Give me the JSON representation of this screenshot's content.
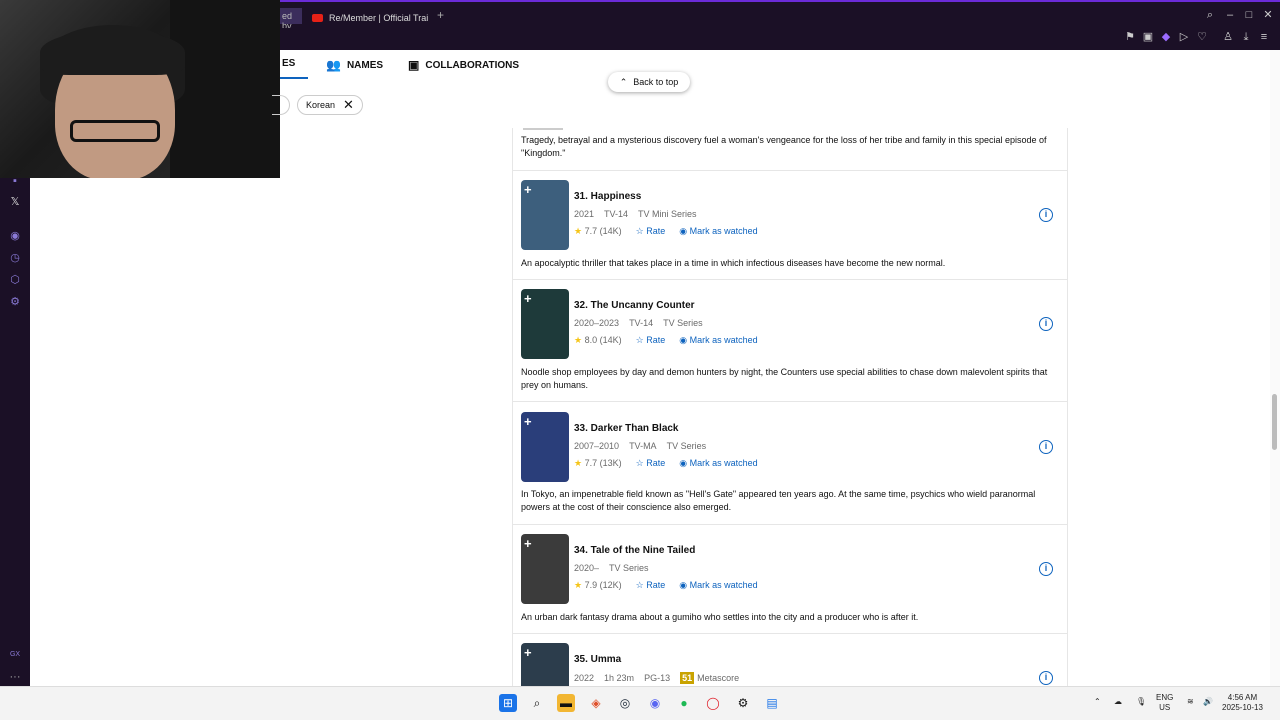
{
  "browser": {
    "tab_partial": "ed by",
    "tab_active": "Re/Member | Official Trai",
    "new_tab": "+"
  },
  "nav": {
    "item_partial": "ES",
    "names": "NAMES",
    "collaborations": "COLLABORATIONS"
  },
  "back_to_top": "Back to top",
  "filters": {
    "chip": "Korean"
  },
  "previous_description": "Tragedy, betrayal and a mysterious discovery fuel a woman's vengeance for the loss of her tribe and family in this special episode of \"Kingdom.\"",
  "actions": {
    "rate": "Rate",
    "watched": "Mark as watched"
  },
  "items": [
    {
      "title": "31. Happiness",
      "meta": [
        "2021",
        "TV-14",
        "TV Mini Series"
      ],
      "rating": "7.7",
      "votes": "(14K)",
      "desc": "An apocalyptic thriller that takes place in a time in which infectious diseases have become the new normal.",
      "poster_color": "#3d5f7d"
    },
    {
      "title": "32. The Uncanny Counter",
      "meta": [
        "2020–2023",
        "TV-14",
        "TV Series"
      ],
      "rating": "8.0",
      "votes": "(14K)",
      "desc": "Noodle shop employees by day and demon hunters by night, the Counters use special abilities to chase down malevolent spirits that prey on humans.",
      "poster_color": "#1e3a3a"
    },
    {
      "title": "33. Darker Than Black",
      "meta": [
        "2007–2010",
        "TV-MA",
        "TV Series"
      ],
      "rating": "7.7",
      "votes": "(13K)",
      "desc": "In Tokyo, an impenetrable field known as \"Hell's Gate\" appeared ten years ago. At the same time, psychics who wield paranormal powers at the cost of their conscience also emerged.",
      "poster_color": "#2a3e7a"
    },
    {
      "title": "34. Tale of the Nine Tailed",
      "meta": [
        "2020–",
        "TV Series"
      ],
      "rating": "7.9",
      "votes": "(12K)",
      "desc": "An urban dark fantasy drama about a gumiho who settles into the city and a producer who is after it.",
      "poster_color": "#3b3b3b"
    },
    {
      "title": "35. Umma",
      "meta": [
        "2022",
        "1h 23m",
        "PG-13"
      ],
      "metascore": "51",
      "metascore_label": "Metascore",
      "poster_color": "#2c3d4c"
    }
  ],
  "taskbar": {
    "lang": "ENG",
    "region": "US",
    "time": "4:56 AM",
    "date": "2025-10-13"
  },
  "sidebar": {
    "badge": "GX",
    "more": "···"
  }
}
